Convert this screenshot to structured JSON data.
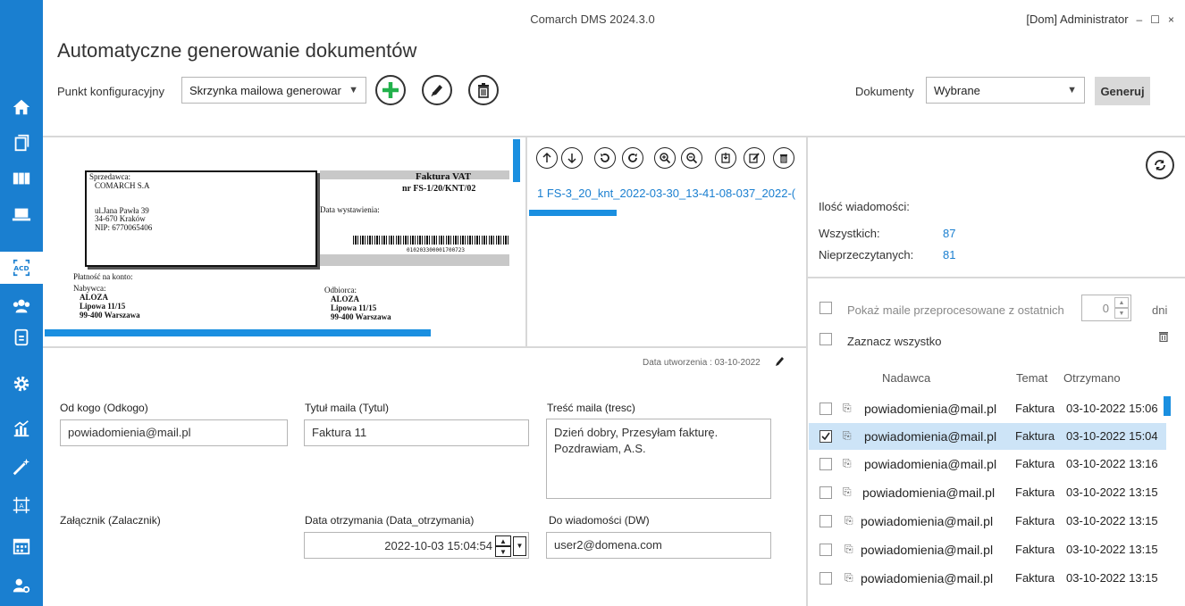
{
  "window": {
    "title": "Comarch DMS 2024.3.0",
    "user": "[Dom]  Administrator",
    "minimize": "–",
    "maximize": "☐",
    "close": "×"
  },
  "page": {
    "title": "Automatyczne generowanie dokumentów"
  },
  "config": {
    "label": "Punkt konfiguracyjny",
    "value": "Skrzynka mailowa generowar",
    "add_icon": "plus-icon",
    "edit_icon": "pencil-icon",
    "delete_icon": "trash-icon"
  },
  "documents": {
    "label": "Dokumenty",
    "value": "Wybrane",
    "generate_label": "Generuj"
  },
  "invoice": {
    "seller_label": "Sprzedawca:",
    "seller_name": "COMARCH S.A",
    "seller_street": "ul.Jana Pawła 39",
    "seller_city": "34-670 Kraków",
    "seller_nip": "NIP: 6770065406",
    "title": "Faktura VAT",
    "number": "nr FS-1/20/KNT/02",
    "issue_date_label": "Data wystawienia:",
    "barcode_number": "010203300001700723",
    "payment": "Płatność na konto:",
    "buyer_label": "Nabywca:",
    "buyer_name": "ALOZA",
    "buyer_street": "Lipowa 11/15",
    "buyer_city": "99-400  Warszawa",
    "recipient_label": "Odbiorca:",
    "recipient_name": "ALOZA",
    "recipient_street": "Lipowa 11/15",
    "recipient_city": "99-400  Warszawa"
  },
  "attachments": {
    "file": "1 FS-3_20_knt_2022-03-30_13-41-08-037_2022-("
  },
  "stats": {
    "title": "Ilość wiadomości:",
    "all_label": "Wszystkich:",
    "all_value": "87",
    "unread_label": "Nieprzeczytanych:",
    "unread_value": "81"
  },
  "filter": {
    "show_processed_label": "Pokaż maile przeprocesowane z ostatnich",
    "days_value": "0",
    "days_unit": "dni",
    "select_all_label": "Zaznacz wszystko"
  },
  "list": {
    "col_sender": "Nadawca",
    "col_topic": "Temat",
    "col_received": "Otrzymano",
    "rows": [
      {
        "sender": "powiadomienia@mail.pl",
        "topic": "Faktura",
        "date": "03-10-2022 15:06"
      },
      {
        "sender": "powiadomienia@mail.pl",
        "topic": "Faktura",
        "date": "03-10-2022 15:04"
      },
      {
        "sender": "powiadomienia@mail.pl",
        "topic": "Faktura",
        "date": "03-10-2022 13:16"
      },
      {
        "sender": "powiadomienia@mail.pl",
        "topic": "Faktura",
        "date": "03-10-2022 13:15"
      },
      {
        "sender": "powiadomienia@mail.pl",
        "topic": "Faktura",
        "date": "03-10-2022 13:15"
      },
      {
        "sender": "powiadomienia@mail.pl",
        "topic": "Faktura",
        "date": "03-10-2022 13:15"
      },
      {
        "sender": "powiadomienia@mail.pl",
        "topic": "Faktura",
        "date": "03-10-2022 13:15"
      }
    ]
  },
  "form": {
    "created_label": "Data utworzenia : 03-10-2022",
    "from_label": "Od kogo (Odkogo)",
    "from_value": "powiadomienia@mail.pl",
    "subject_label": "Tytuł maila (Tytul)",
    "subject_value": "Faktura 11",
    "body_label": "Treść maila (tresc)",
    "body_value": "Dzień dobry,   Przesyłam fakturę. Pozdrawiam,  A.S.",
    "attachment_label": "Załącznik (Zalacznik)",
    "received_label": "Data otrzymania (Data_otrzymania)",
    "received_value": "2022-10-03  15:04:54",
    "cc_label": "Do wiadomości (DW)",
    "cc_value": "user2@domena.com"
  },
  "colors": {
    "accent": "#1a7fd0",
    "selected_row": "#cde4f7",
    "add_green": "#22b14c"
  }
}
